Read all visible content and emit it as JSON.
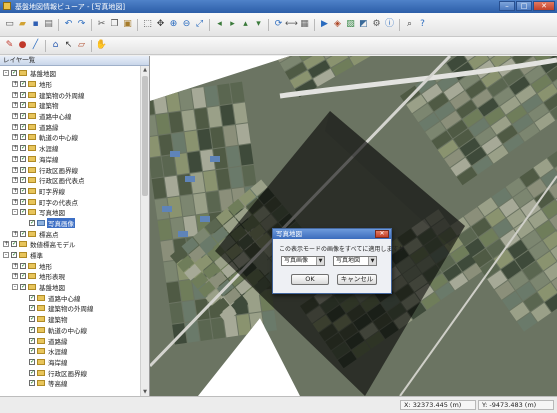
{
  "window": {
    "title": "基盤地図情報ビューア - [写真地図]",
    "minimize": "–",
    "maximize": "□",
    "close": "✕"
  },
  "toolbar1": [
    "new-icon",
    "open-icon",
    "save-icon",
    "print-icon",
    "|",
    "undo-icon",
    "redo-icon",
    "|",
    "cut-icon",
    "copy-icon",
    "paste-icon",
    "|",
    "select-icon",
    "pan-icon",
    "zoom-in-icon",
    "zoom-out-icon",
    "zoom-full-icon",
    "|",
    "arrow-left-icon",
    "arrow-right-icon",
    "arrow-up-icon",
    "arrow-down-icon",
    "|",
    "refresh-icon",
    "measure-icon",
    "grid-icon",
    "|",
    "play-icon",
    "layer-icon",
    "image-icon",
    "photo-icon",
    "settings-icon",
    "info-icon",
    "|",
    "search-icon",
    "help-icon"
  ],
  "toolbar2": [
    "draw-icon",
    "point-icon",
    "line-icon",
    "|",
    "house-icon",
    "pointer-icon",
    "eraser-icon",
    "|",
    "hand-icon"
  ],
  "layer_panel": {
    "title": "レイヤ一覧",
    "items": [
      {
        "level": 0,
        "label": "基盤地図",
        "toggle": "-",
        "checked": true,
        "icon": "folder"
      },
      {
        "level": 1,
        "label": "地形",
        "toggle": "+",
        "checked": true,
        "icon": "folder"
      },
      {
        "level": 1,
        "label": "建築物の外周線",
        "toggle": "+",
        "checked": true,
        "icon": "folder"
      },
      {
        "level": 1,
        "label": "建築物",
        "toggle": "+",
        "checked": true,
        "icon": "folder"
      },
      {
        "level": 1,
        "label": "道路中心線",
        "toggle": "+",
        "checked": true,
        "icon": "folder"
      },
      {
        "level": 1,
        "label": "道路縁",
        "toggle": "+",
        "checked": true,
        "icon": "folder"
      },
      {
        "level": 1,
        "label": "軌道の中心線",
        "toggle": "+",
        "checked": true,
        "icon": "folder"
      },
      {
        "level": 1,
        "label": "水涯線",
        "toggle": "+",
        "checked": true,
        "icon": "folder"
      },
      {
        "level": 1,
        "label": "海岸線",
        "toggle": "+",
        "checked": true,
        "icon": "folder"
      },
      {
        "level": 1,
        "label": "行政区画界線",
        "toggle": "+",
        "checked": true,
        "icon": "folder"
      },
      {
        "level": 1,
        "label": "行政区画代表点",
        "toggle": "+",
        "checked": true,
        "icon": "folder"
      },
      {
        "level": 1,
        "label": "町字界線",
        "toggle": "+",
        "checked": true,
        "icon": "folder"
      },
      {
        "level": 1,
        "label": "町字の代表点",
        "toggle": "+",
        "checked": true,
        "icon": "folder"
      },
      {
        "level": 1,
        "label": "写真地図",
        "toggle": "-",
        "checked": true,
        "icon": "folder"
      },
      {
        "level": 2,
        "label": "写真画像",
        "toggle": "",
        "checked": true,
        "icon": "image",
        "selected": true
      },
      {
        "level": 1,
        "label": "標高点",
        "toggle": "+",
        "checked": true,
        "icon": "folder"
      },
      {
        "level": 0,
        "label": "数値標高モデル",
        "toggle": "+",
        "checked": true,
        "icon": "folder"
      },
      {
        "level": 0,
        "label": "標準",
        "toggle": "-",
        "checked": true,
        "icon": "folder"
      },
      {
        "level": 1,
        "label": "地形",
        "toggle": "+",
        "checked": true,
        "icon": "folder"
      },
      {
        "level": 1,
        "label": "地形表現",
        "toggle": "+",
        "checked": true,
        "icon": "folder"
      },
      {
        "level": 1,
        "label": "基盤地図",
        "toggle": "-",
        "checked": true,
        "icon": "folder"
      },
      {
        "level": 2,
        "label": "道路中心線",
        "toggle": "",
        "checked": true,
        "icon": "folder"
      },
      {
        "level": 2,
        "label": "建築物の外周線",
        "toggle": "",
        "checked": true,
        "icon": "folder"
      },
      {
        "level": 2,
        "label": "建築物",
        "toggle": "",
        "checked": true,
        "icon": "folder"
      },
      {
        "level": 2,
        "label": "軌道の中心線",
        "toggle": "",
        "checked": true,
        "icon": "folder"
      },
      {
        "level": 2,
        "label": "道路縁",
        "toggle": "",
        "checked": true,
        "icon": "folder"
      },
      {
        "level": 2,
        "label": "水涯線",
        "toggle": "",
        "checked": true,
        "icon": "folder"
      },
      {
        "level": 2,
        "label": "海岸線",
        "toggle": "",
        "checked": true,
        "icon": "folder"
      },
      {
        "level": 2,
        "label": "行政区画界線",
        "toggle": "",
        "checked": true,
        "icon": "folder"
      },
      {
        "level": 2,
        "label": "等高線",
        "toggle": "",
        "checked": true,
        "icon": "folder"
      }
    ]
  },
  "dialog": {
    "title": "写真地図",
    "message": "この表示モードの画像をすべてに適用しますか",
    "select1": "写真画像",
    "select2": "写真地図",
    "ok": "OK",
    "cancel": "キャンセル",
    "close": "✕"
  },
  "status": {
    "x": "X: 32373.445 (m)",
    "y": "Y: -9473.483 (m)"
  },
  "colors": {
    "titlebar": "#2c5ea8",
    "selection": "#3d6fc5",
    "dialog_border": "#44679e"
  }
}
